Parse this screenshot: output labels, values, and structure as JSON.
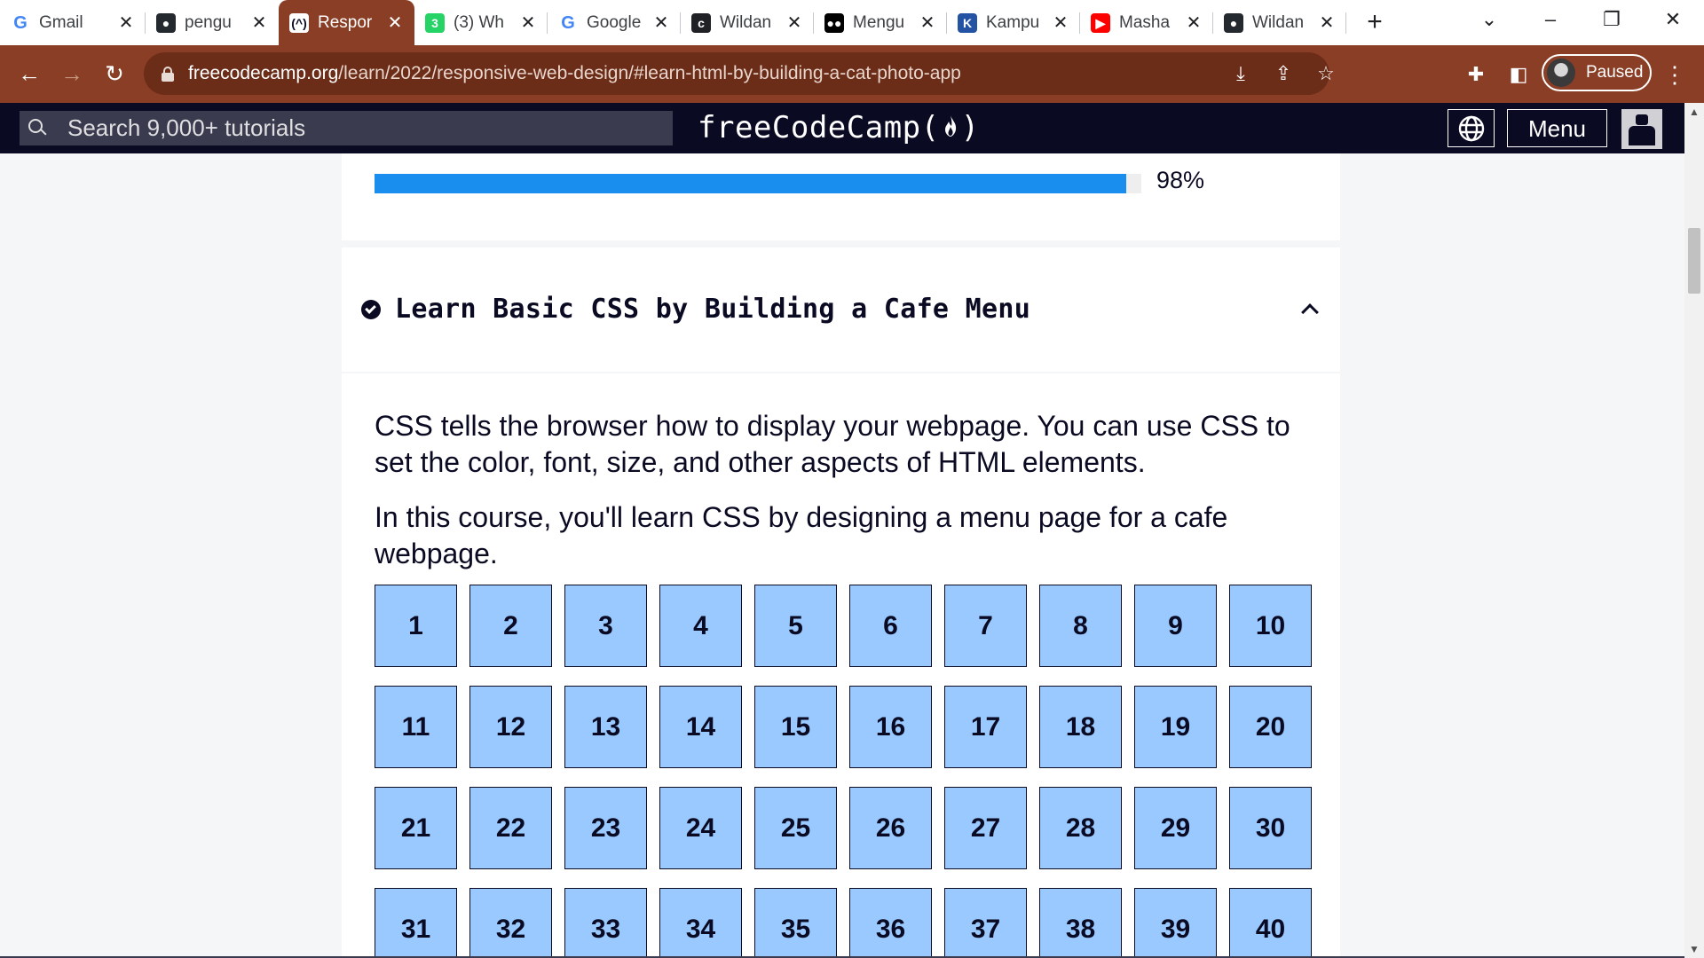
{
  "browser": {
    "tabs": [
      {
        "title": "Gmail",
        "icon": "gmail-google-icon",
        "favicon_letter": "G",
        "favicon_color": "#4285f4"
      },
      {
        "title": "pengu",
        "icon": "github-icon",
        "favicon_letter": "●",
        "favicon_color": "#24292f"
      },
      {
        "title": "Respor",
        "icon": "freecodecamp-icon",
        "favicon_letter": "(^)",
        "favicon_color": "#0a0a23",
        "active": true
      },
      {
        "title": "(3) Wh",
        "icon": "whatsapp-icon",
        "favicon_letter": "3",
        "favicon_color": "#25d366"
      },
      {
        "title": "Google",
        "icon": "google-translate-icon",
        "favicon_letter": "G",
        "favicon_color": "#4285f4"
      },
      {
        "title": "Wildan",
        "icon": "codepen-icon",
        "favicon_letter": "c",
        "favicon_color": "#202124"
      },
      {
        "title": "Mengu",
        "icon": "medium-icon",
        "favicon_letter": "●●",
        "favicon_color": "#000000"
      },
      {
        "title": "Kampu",
        "icon": "kampus-merdeka-icon",
        "favicon_letter": "K",
        "favicon_color": "#2453a4"
      },
      {
        "title": "Masha",
        "icon": "youtube-icon",
        "favicon_letter": "▶",
        "favicon_color": "#ff0000"
      },
      {
        "title": "Wildan",
        "icon": "github-icon",
        "favicon_letter": "●",
        "favicon_color": "#24292f"
      }
    ],
    "tab_close_glyph": "✕",
    "new_tab_glyph": "+",
    "url_domain": "freecodecamp.org",
    "url_path": "/learn/2022/responsive-web-design/#learn-html-by-building-a-cat-photo-app",
    "profile_status": "Paused",
    "colors": {
      "toolbar": "#8a3e25",
      "omnibox": "#6b2c18"
    }
  },
  "fcc_nav": {
    "search_placeholder": "Search 9,000+ tutorials",
    "brand": "freeCodeCamp(🔥)",
    "brand_text": "freeCodeCamp(",
    "brand_close": ")",
    "menu_label": "Menu",
    "colors": {
      "background": "#0a0a23",
      "search_bg": "#3b3b4f"
    }
  },
  "progress": {
    "value_percent": 98,
    "label": "98%",
    "fill_color": "#198eee"
  },
  "block": {
    "title": "Learn Basic CSS by Building a Cafe Menu",
    "completed": true,
    "expanded": true,
    "description_1": "CSS tells the browser how to display your webpage. You can use CSS to set the color, font, size, and other aspects of HTML elements.",
    "description_2": "In this course, you'll learn CSS by designing a menu page for a cafe webpage.",
    "step_color": "#99c9ff",
    "steps": [
      "1",
      "2",
      "3",
      "4",
      "5",
      "6",
      "7",
      "8",
      "9",
      "10",
      "11",
      "12",
      "13",
      "14",
      "15",
      "16",
      "17",
      "18",
      "19",
      "20",
      "21",
      "22",
      "23",
      "24",
      "25",
      "26",
      "27",
      "28",
      "29",
      "30",
      "31",
      "32",
      "33",
      "34",
      "35",
      "36",
      "37",
      "38",
      "39",
      "40"
    ]
  }
}
